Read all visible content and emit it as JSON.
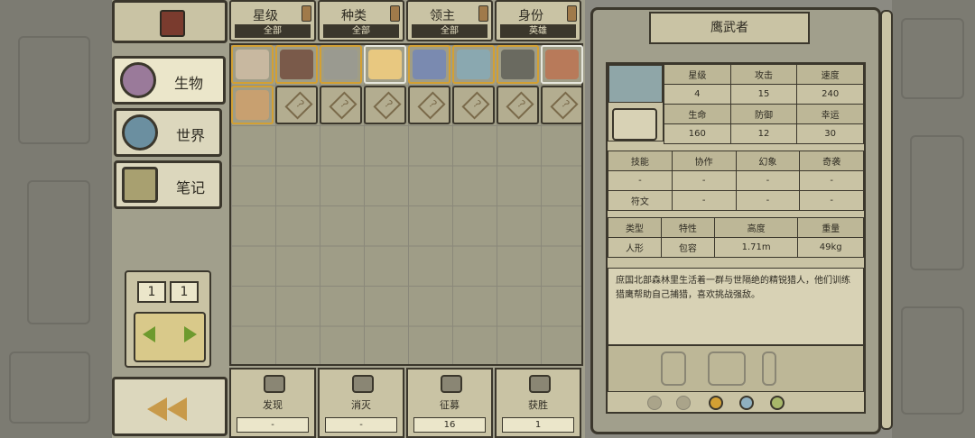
{
  "left_menu": {
    "categories": [
      {
        "label": "生物",
        "icon": "creature-icon",
        "active": true
      },
      {
        "label": "世界",
        "icon": "world-icon",
        "active": false
      },
      {
        "label": "笔记",
        "icon": "notes-icon",
        "active": false
      }
    ],
    "pager": {
      "current": "1",
      "total": "1"
    }
  },
  "filters": [
    {
      "name": "星级",
      "value": "全部"
    },
    {
      "name": "种类",
      "value": "全部"
    },
    {
      "name": "领主",
      "value": "全部"
    },
    {
      "name": "身份",
      "value": "英雄"
    }
  ],
  "creatures": [
    {
      "icon": "knight-helmet-portrait",
      "frame": "gold"
    },
    {
      "icon": "dark-hair-girl-portrait",
      "frame": "gold"
    },
    {
      "icon": "iron-mask-portrait",
      "frame": "gold"
    },
    {
      "icon": "blonde-girl-portrait",
      "frame": "silver"
    },
    {
      "icon": "horned-viking-portrait",
      "frame": "gold"
    },
    {
      "icon": "falconer-portrait",
      "frame": "gold"
    },
    {
      "icon": "bald-warrior-portrait",
      "frame": "gold"
    },
    {
      "icon": "goblin-portrait",
      "frame": "silver"
    },
    {
      "icon": "helmet-woman-portrait",
      "frame": "gold"
    },
    {
      "icon": "unknown-icon",
      "frame": "none"
    },
    {
      "icon": "unknown-icon",
      "frame": "none"
    },
    {
      "icon": "unknown-icon",
      "frame": "none"
    },
    {
      "icon": "unknown-icon",
      "frame": "none"
    },
    {
      "icon": "unknown-icon",
      "frame": "none"
    },
    {
      "icon": "unknown-icon",
      "frame": "none"
    },
    {
      "icon": "unknown-icon",
      "frame": "none"
    }
  ],
  "bottom_stats": [
    {
      "label": "发现",
      "value": "-",
      "icon": "eye-icon"
    },
    {
      "label": "消灭",
      "value": "-",
      "icon": "skull-icon"
    },
    {
      "label": "征募",
      "value": "16",
      "icon": "flag-icon"
    },
    {
      "label": "获胜",
      "value": "1",
      "icon": "trophy-icon"
    }
  ],
  "detail": {
    "name": "鹰武者",
    "stats_headers": [
      "星级",
      "攻击",
      "速度"
    ],
    "stats_values": [
      "4",
      "15",
      "240"
    ],
    "stats_headers2": [
      "生命",
      "防御",
      "幸运"
    ],
    "stats_values2": [
      "160",
      "12",
      "30"
    ],
    "skill_headers": [
      "技能",
      "协作",
      "幻象",
      "奇袭"
    ],
    "skill_row": [
      "-",
      "-",
      "-",
      "-"
    ],
    "rune_row": [
      "符文",
      "-",
      "-",
      "-"
    ],
    "traits_headers": [
      "类型",
      "特性",
      "高度",
      "重量"
    ],
    "traits_values": [
      "人形",
      "包容",
      "1.71m",
      "49kg"
    ],
    "description": "庶国北部森林里生活着一群与世隔绝的精锐猎人，他们训练猎鹰帮助自己捕猎，喜欢挑战强敌。"
  }
}
